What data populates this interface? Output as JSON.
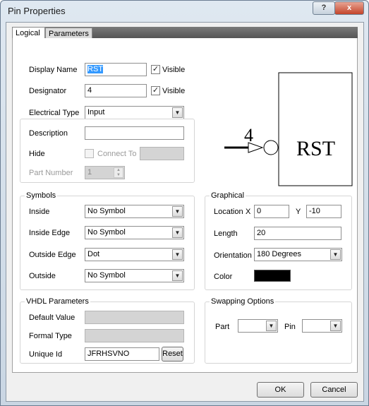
{
  "window": {
    "title": "Pin Properties",
    "help_label": "?",
    "close_label": "x"
  },
  "tabs": [
    {
      "label": "Logical"
    },
    {
      "label": "Parameters"
    }
  ],
  "logical": {
    "display_name_label": "Display Name",
    "display_name_value": "RST",
    "designator_label": "Designator",
    "designator_value": "4",
    "visible_label": "Visible",
    "electrical_type_label": "Electrical Type",
    "electrical_type_value": "Input",
    "description_label": "Description",
    "description_value": "",
    "hide_label": "Hide",
    "connect_to_label": "Connect To",
    "part_number_label": "Part Number",
    "part_number_value": "1"
  },
  "preview": {
    "pin_number": "4",
    "pin_name": "RST"
  },
  "symbols": {
    "title": "Symbols",
    "inside_label": "Inside",
    "inside_value": "No Symbol",
    "inside_edge_label": "Inside Edge",
    "inside_edge_value": "No Symbol",
    "outside_edge_label": "Outside Edge",
    "outside_edge_value": "Dot",
    "outside_label": "Outside",
    "outside_value": "No Symbol"
  },
  "graphical": {
    "title": "Graphical",
    "location_label": "Location",
    "x_label": "X",
    "x_value": "0",
    "y_label": "Y",
    "y_value": "-10",
    "length_label": "Length",
    "length_value": "20",
    "orientation_label": "Orientation",
    "orientation_value": "180 Degrees",
    "color_label": "Color",
    "color_value": "#000000"
  },
  "vhdl": {
    "title": "VHDL Parameters",
    "default_value_label": "Default Value",
    "formal_type_label": "Formal Type",
    "unique_id_label": "Unique Id",
    "unique_id_value": "JFRHSVNO",
    "reset_label": "Reset"
  },
  "swapping": {
    "title": "Swapping Options",
    "part_label": "Part",
    "pin_label": "Pin"
  },
  "footer": {
    "ok_label": "OK",
    "cancel_label": "Cancel"
  }
}
